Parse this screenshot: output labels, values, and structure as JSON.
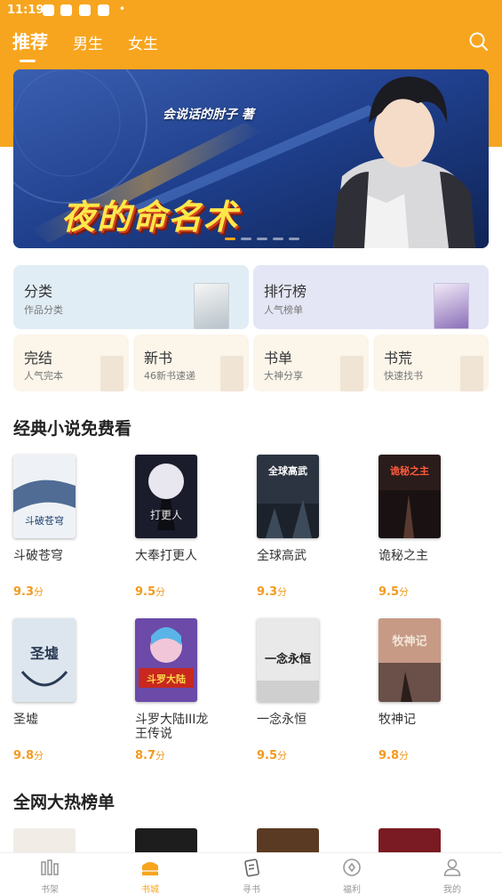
{
  "status_bar": {
    "time": "11:19",
    "dot": "•"
  },
  "header": {
    "tabs": [
      {
        "label": "推荐"
      },
      {
        "label": "男生"
      },
      {
        "label": "女生"
      }
    ],
    "search_icon": "search-icon"
  },
  "banner": {
    "author": "会说话的肘子 著",
    "title": "夜的命名术",
    "slides": 5,
    "active_slide": 0
  },
  "categories": [
    {
      "title": "分类",
      "subtitle": "作品分类"
    },
    {
      "title": "排行榜",
      "subtitle": "人气榜单"
    },
    {
      "title": "完结",
      "subtitle": "人气完本"
    },
    {
      "title": "新书",
      "subtitle": "46新书速递"
    },
    {
      "title": "书单",
      "subtitle": "大神分享"
    },
    {
      "title": "书荒",
      "subtitle": "快速找书"
    }
  ],
  "section1": {
    "title": "经典小说免费看",
    "books": [
      {
        "name": "斗破苍穹",
        "score": "9.3",
        "unit": "分",
        "cover_color": "#eef2f6",
        "cover_text": "斗破苍穹",
        "text_color": "#1d3d6e"
      },
      {
        "name": "大奉打更人",
        "score": "9.5",
        "unit": "分",
        "cover_color": "#1a1c2c",
        "cover_text": "打更人",
        "text_color": "#e6e6e6"
      },
      {
        "name": "全球高武",
        "score": "9.3",
        "unit": "分",
        "cover_color": "#2b3440",
        "cover_text": "全球高武",
        "text_color": "#ffffff"
      },
      {
        "name": "诡秘之主",
        "score": "9.5",
        "unit": "分",
        "cover_color": "#2a1c1a",
        "cover_text": "诡秘之主",
        "text_color": "#ff5a3c"
      },
      {
        "name": "圣墟",
        "score": "9.8",
        "unit": "分",
        "cover_color": "#dde6ee",
        "cover_text": "圣墟",
        "text_color": "#2a3a55"
      },
      {
        "name": "斗罗大陆III龙王传说",
        "score": "8.7",
        "unit": "分",
        "cover_color": "#6b4aa8",
        "cover_text": "斗罗大陆",
        "text_color": "#ffd84a"
      },
      {
        "name": "一念永恒",
        "score": "9.5",
        "unit": "分",
        "cover_color": "#e9e9e9",
        "cover_text": "一念永恒",
        "text_color": "#222222"
      },
      {
        "name": "牧神记",
        "score": "9.8",
        "unit": "分",
        "cover_color": "#6a5048",
        "cover_text": "牧神记",
        "text_color": "#f2e6d8"
      }
    ]
  },
  "section2": {
    "title": "全网大热榜单",
    "covers": [
      "#f1ece6",
      "#1d1d1d",
      "#5a3a22",
      "#7a1a22"
    ]
  },
  "bottom_nav": [
    {
      "label": "书架",
      "icon": "bookshelf-icon"
    },
    {
      "label": "书城",
      "icon": "bookstore-icon"
    },
    {
      "label": "寻书",
      "icon": "find-book-icon"
    },
    {
      "label": "福利",
      "icon": "welfare-icon"
    },
    {
      "label": "我的",
      "icon": "profile-icon"
    }
  ],
  "colors": {
    "accent": "#f7a51e",
    "score": "#f39a1e"
  }
}
